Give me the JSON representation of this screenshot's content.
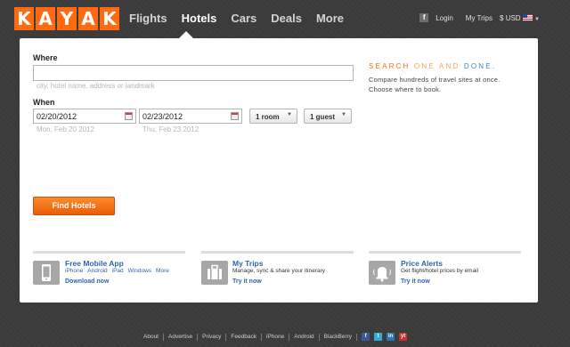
{
  "header": {
    "logo_letters": [
      "K",
      "A",
      "Y",
      "A",
      "K"
    ],
    "nav": [
      {
        "label": "Flights"
      },
      {
        "label": "Hotels"
      },
      {
        "label": "Cars"
      },
      {
        "label": "Deals"
      },
      {
        "label": "More"
      }
    ],
    "login_label": "Login",
    "my_trips_label": "My Trips",
    "currency_label": "$ USD"
  },
  "search": {
    "where_label": "Where",
    "where_value": "",
    "where_hint": "city, hotel name, address or landmark",
    "when_label": "When",
    "checkin_value": "02/20/2012",
    "checkout_value": "02/23/2012",
    "checkin_hint": "Mon, Feb 20 2012",
    "checkout_hint": "Thu, Feb 23 2012",
    "rooms_value": "1 room",
    "guests_value": "1 guest",
    "submit_label": "Find Hotels"
  },
  "tagline": {
    "part1": "SEARCH",
    "part2": "ONE",
    "part3": "AND",
    "part4": "DONE.",
    "line1": "Compare hundreds of travel sites at once.",
    "line2": "Choose where to book."
  },
  "promos": [
    {
      "title": "Free Mobile App",
      "links": [
        "iPhone",
        "Android",
        "iPad",
        "Windows",
        "More"
      ],
      "cta": "Download now"
    },
    {
      "title": "My Trips",
      "subtitle": "Manage, sync & share your itinerary",
      "cta": "Try it now"
    },
    {
      "title": "Price Alerts",
      "subtitle": "Get flight/hotel prices by email",
      "cta": "Try it now"
    }
  ],
  "footer": {
    "links": [
      "About",
      "Advertise",
      "Privacy",
      "Feedback",
      "iPhone",
      "Android",
      "BlackBerry"
    ],
    "social": [
      "f",
      "t",
      "in",
      "yt"
    ]
  },
  "colors": {
    "brand_orange": "#ff690f",
    "link_blue": "#2f64ad",
    "background": "#3b3b3b"
  }
}
